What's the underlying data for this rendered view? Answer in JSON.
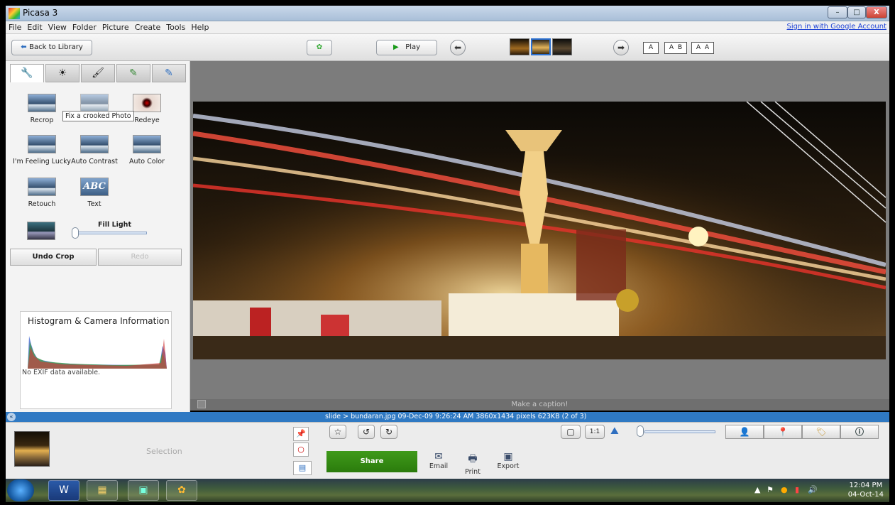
{
  "window": {
    "title": "Picasa 3",
    "min": "–",
    "max": "□",
    "close": "X"
  },
  "menu": {
    "items": [
      "File",
      "Edit",
      "View",
      "Folder",
      "Picture",
      "Create",
      "Tools",
      "Help"
    ],
    "sign_in": "Sign in with Google Account"
  },
  "toolbar": {
    "back_label": "Back to Library",
    "play_label": "Play",
    "caption_modes": [
      "A",
      "A B",
      "A A"
    ]
  },
  "left_panel": {
    "tabs": [
      "wrench-icon",
      "sun-icon",
      "brush-icon",
      "paint-brush-icon",
      "blue-brush-icon"
    ],
    "tools": [
      {
        "label": "Recrop"
      },
      {
        "label": "Straighten"
      },
      {
        "label": "Redeye"
      },
      {
        "label": "I'm Feeling Lucky"
      },
      {
        "label": "Auto Contrast"
      },
      {
        "label": "Auto Color"
      },
      {
        "label": "Retouch"
      },
      {
        "label": "Text"
      }
    ],
    "tooltip": "Fix a crooked Photo",
    "text_tool_glyph": "ABC",
    "fill_light_label": "Fill Light",
    "fill_light_value": 0,
    "undo_label": "Undo Crop",
    "redo_label": "Redo",
    "histogram_title": "Histogram & Camera Information",
    "exif_text": "No EXIF data available."
  },
  "viewer": {
    "caption_placeholder": "Make a caption!"
  },
  "status": {
    "text": "slide > bundaran.jpg   09-Dec-09 9:26:24 AM   3860x1434 pixels   623KB   (2 of 3)"
  },
  "tray": {
    "selection_label": "Selection",
    "share_label": "Share",
    "actions": [
      "Email",
      "Print",
      "Export"
    ]
  },
  "taskbar": {
    "time": "12:04 PM",
    "date": "04-Oct-14"
  },
  "colors": {
    "status_bar": "#2f79c3",
    "share_button": "#2b7b0c",
    "signin_link": "#1a3fd4"
  }
}
